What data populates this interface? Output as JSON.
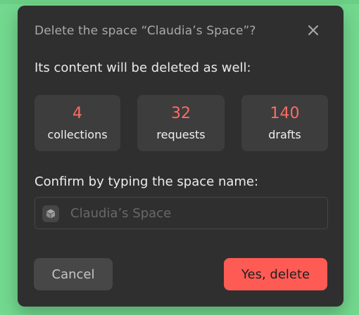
{
  "dialog": {
    "title": "Delete the space “Claudia’s Space”?",
    "close_icon": "close-icon",
    "subtitle": "Its content will be deleted as well:",
    "stats": [
      {
        "value": "4",
        "label": "collections"
      },
      {
        "value": "32",
        "label": "requests"
      },
      {
        "value": "140",
        "label": "drafts"
      }
    ],
    "confirm_label": "Confirm by typing the space name:",
    "input": {
      "placeholder": "Claudia’s Space",
      "value": "",
      "icon": "cube-icon"
    },
    "cancel_label": "Cancel",
    "delete_label": "Yes, delete"
  },
  "colors": {
    "background": "#73d98f",
    "dialog": "#2f2f2f",
    "accent": "#ff5b55"
  }
}
